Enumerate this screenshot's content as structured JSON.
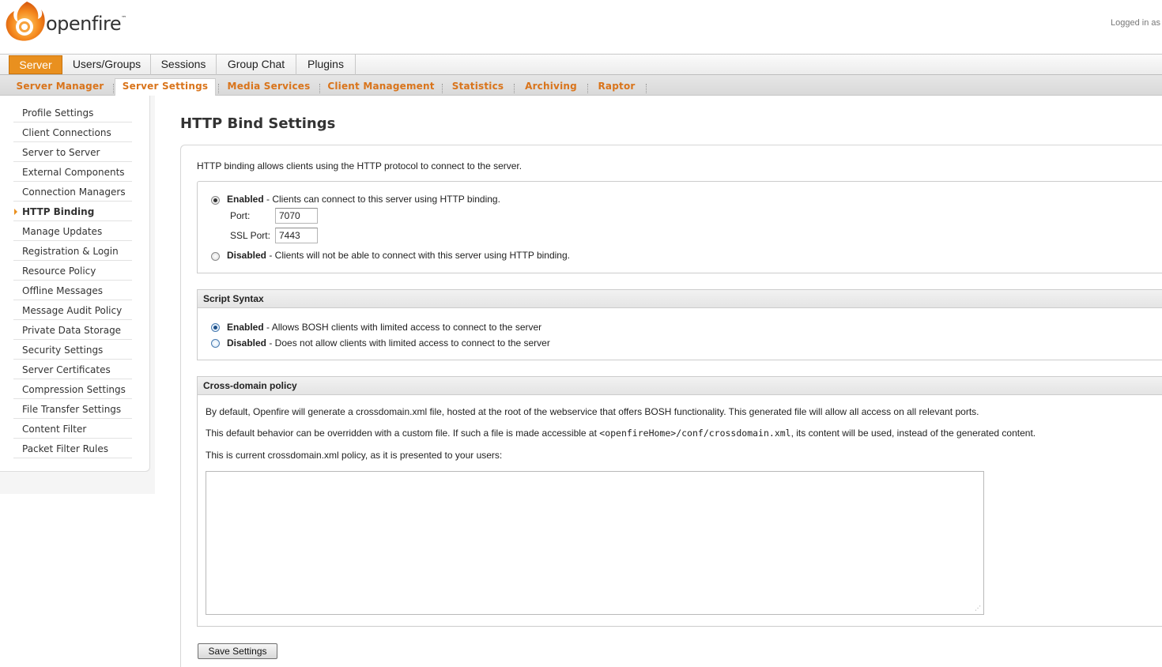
{
  "header": {
    "logo_text": "openfire",
    "logo_tm": "™",
    "logged_in": "Logged in as"
  },
  "main_tabs": [
    {
      "label": "Server",
      "active": true
    },
    {
      "label": "Users/Groups"
    },
    {
      "label": "Sessions"
    },
    {
      "label": "Group Chat"
    },
    {
      "label": "Plugins"
    }
  ],
  "sub_tabs": [
    {
      "label": "Server Manager"
    },
    {
      "label": "Server Settings",
      "active": true
    },
    {
      "label": "Media Services"
    },
    {
      "label": "Client Management"
    },
    {
      "label": "Statistics"
    },
    {
      "label": "Archiving"
    },
    {
      "label": "Raptor"
    }
  ],
  "sidebar": {
    "items": [
      {
        "label": "Profile Settings"
      },
      {
        "label": "Client Connections"
      },
      {
        "label": "Server to Server"
      },
      {
        "label": "External Components"
      },
      {
        "label": "Connection Managers"
      },
      {
        "label": "HTTP Binding",
        "active": true
      },
      {
        "label": "Manage Updates"
      },
      {
        "label": "Registration & Login"
      },
      {
        "label": "Resource Policy"
      },
      {
        "label": "Offline Messages"
      },
      {
        "label": "Message Audit Policy"
      },
      {
        "label": "Private Data Storage"
      },
      {
        "label": "Security Settings"
      },
      {
        "label": "Server Certificates"
      },
      {
        "label": "Compression Settings"
      },
      {
        "label": "File Transfer Settings"
      },
      {
        "label": "Content Filter"
      },
      {
        "label": "Packet Filter Rules"
      }
    ]
  },
  "page": {
    "title": "HTTP Bind Settings",
    "intro": "HTTP binding allows clients using the HTTP protocol to connect to the server."
  },
  "binding": {
    "enabled_label": "Enabled",
    "enabled_desc": " - Clients can connect to this server using HTTP binding.",
    "enabled_checked": true,
    "port_label": "Port:",
    "port_value": "7070",
    "ssl_port_label": "SSL Port:",
    "ssl_port_value": "7443",
    "disabled_label": "Disabled",
    "disabled_desc": " - Clients will not be able to connect with this server using HTTP binding."
  },
  "script_syntax": {
    "title": "Script Syntax",
    "enabled_label": "Enabled",
    "enabled_desc": " - Allows BOSH clients with limited access to connect to the server",
    "enabled_checked": true,
    "disabled_label": "Disabled",
    "disabled_desc": " - Does not allow clients with limited access to connect to the server"
  },
  "cross_domain": {
    "title": "Cross-domain policy",
    "para1": "By default, Openfire will generate a crossdomain.xml file, hosted at the root of the webservice that offers BOSH functionality. This generated file will allow all access on all relevant ports.",
    "para2_before": "This default behavior can be overridden with a custom file. If such a file is made accessible at ",
    "para2_code": "<openfireHome>/conf/crossdomain.xml",
    "para2_after": ", its content will be used, instead of the generated content.",
    "para3": "This is current crossdomain.xml policy, as it is presented to your users:",
    "policy_text": ""
  },
  "actions": {
    "save_label": "Save Settings"
  },
  "colors": {
    "accent": "#e9901f",
    "subtab_text": "#d9741b"
  }
}
